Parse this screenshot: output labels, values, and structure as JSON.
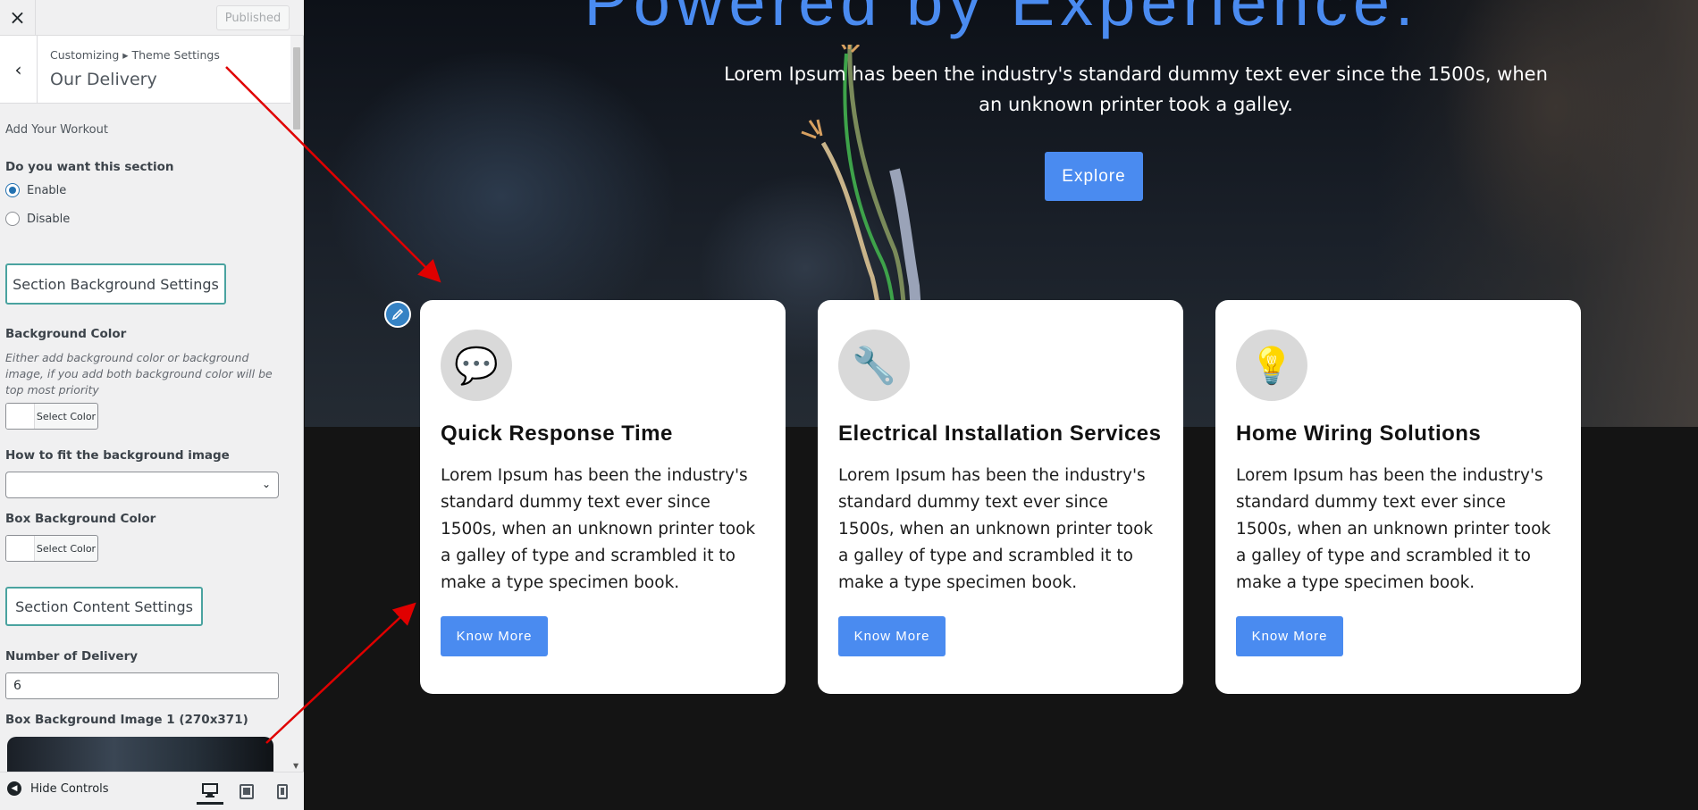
{
  "header": {
    "close_icon": "×",
    "published_label": "Published"
  },
  "section": {
    "breadcrumb": "Customizing ▸ Theme Settings",
    "title": "Our Delivery"
  },
  "controls": {
    "intro_label": "Add Your Workout",
    "enable_question": "Do you want this section",
    "options": [
      {
        "label": "Enable",
        "checked": true
      },
      {
        "label": "Disable",
        "checked": false
      }
    ],
    "bg_settings_button": "Section Background Settings",
    "bg_color_label": "Background Color",
    "bg_color_desc": "Either add background color or background image, if you add both background color will be top most priority",
    "select_color": "Select Color",
    "fit_label": "How to fit the background image",
    "fit_value": "",
    "box_bg_color_label": "Box Background Color",
    "content_settings_button": "Section Content Settings",
    "number_label": "Number of Delivery",
    "number_value": "6",
    "box_image_label": "Box Background Image 1 (270x371)"
  },
  "footer": {
    "hide_controls": "Hide Controls",
    "devices": [
      "desktop",
      "tablet",
      "mobile"
    ]
  },
  "preview": {
    "hero_title": "Powered by Experience.",
    "hero_text": "Lorem Ipsum has been the industry's standard dummy text ever since the 1500s, when an unknown printer took a galley.",
    "explore_label": "Explore",
    "cards": [
      {
        "icon": "speech-bubble-icon",
        "glyph": "💬",
        "title": "Quick Response Time",
        "text": "Lorem Ipsum has been the industry's standard dummy text ever since 1500s, when an unknown printer took a galley of type and scrambled it to make a type specimen book.",
        "button": "Know More"
      },
      {
        "icon": "wrench-icon",
        "glyph": "🔧",
        "title": "Electrical Installation Services",
        "text": "Lorem Ipsum has been the industry's standard dummy text ever since 1500s, when an unknown printer took a galley of type and scrambled it to make a type specimen book.",
        "button": "Know More"
      },
      {
        "icon": "lightbulb-icon",
        "glyph": "💡",
        "title": "Home Wiring Solutions",
        "text": "Lorem Ipsum has been the industry's standard dummy text ever since 1500s, when an unknown printer took a galley of type and scrambled it to make a type specimen book.",
        "button": "Know More"
      }
    ]
  },
  "colors": {
    "accent": "#4a8bf0",
    "outline_button_border": "#4aa3a0",
    "annotation_arrow": "#e00000"
  }
}
